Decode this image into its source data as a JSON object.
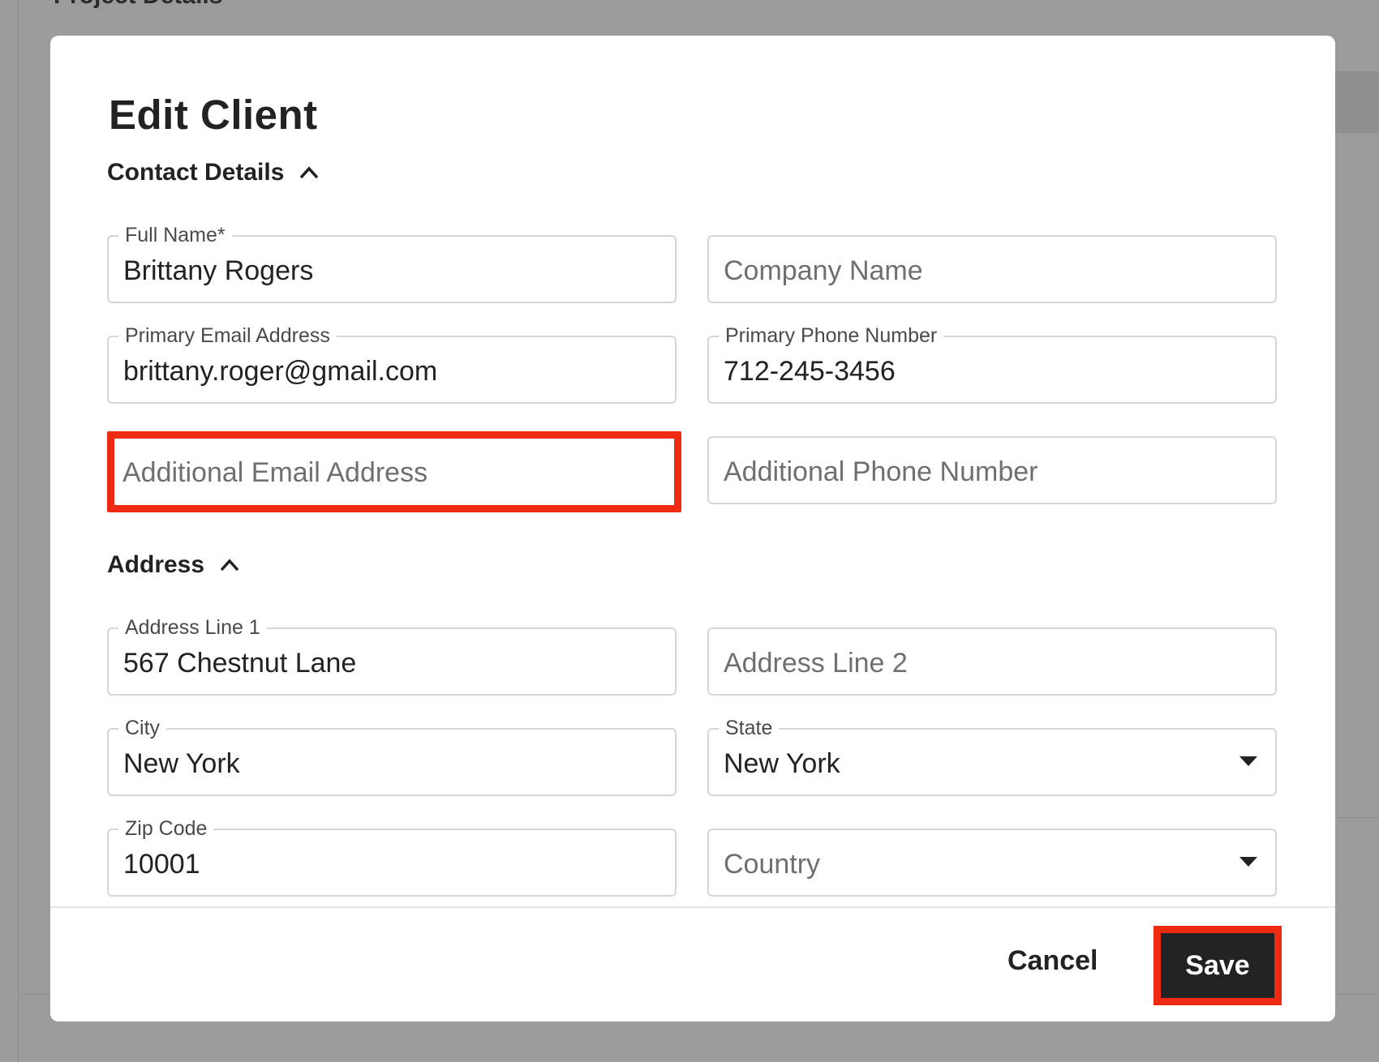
{
  "background": {
    "heading": "Project Details"
  },
  "modal": {
    "title": "Edit Client",
    "contact_section": {
      "title": "Contact Details",
      "full_name": {
        "label": "Full Name*",
        "value": "Brittany Rogers"
      },
      "company_name": {
        "placeholder": "Company Name"
      },
      "primary_email": {
        "label": "Primary Email Address",
        "value": "brittany.roger@gmail.com"
      },
      "primary_phone": {
        "label": "Primary Phone Number",
        "value": "712-245-3456"
      },
      "additional_email": {
        "placeholder": "Additional Email Address"
      },
      "additional_phone": {
        "placeholder": "Additional Phone Number"
      }
    },
    "address_section": {
      "title": "Address",
      "address_line1": {
        "label": "Address Line 1",
        "value": "567 Chestnut Lane"
      },
      "address_line2": {
        "placeholder": "Address Line 2"
      },
      "city": {
        "label": "City",
        "value": "New York"
      },
      "state": {
        "label": "State",
        "value": "New York"
      },
      "zip": {
        "label": "Zip Code",
        "value": "10001"
      },
      "country": {
        "placeholder": "Country"
      }
    },
    "footer": {
      "cancel_label": "Cancel",
      "save_label": "Save"
    }
  },
  "colors": {
    "highlight": "#ee2a12",
    "primary_button": "#222222",
    "overlay": "#9b9b9b"
  },
  "icons": {
    "collapse": "chevron-up-icon",
    "dropdown": "caret-down-icon"
  }
}
